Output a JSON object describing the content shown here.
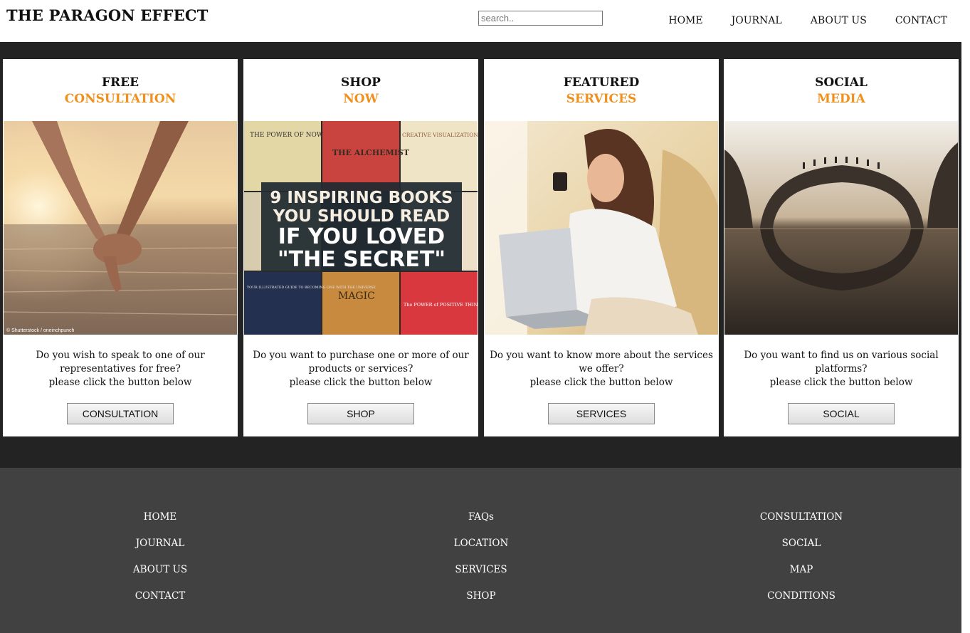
{
  "header": {
    "site_title": "THE PARAGON EFFECT",
    "search_placeholder": "search..",
    "nav": [
      "HOME",
      "JOURNAL",
      "ABOUT US",
      "CONTACT"
    ]
  },
  "cards": [
    {
      "heading_line1": "FREE",
      "heading_line2": "CONSULTATION",
      "text_lines": [
        "Do you wish to speak to one of our",
        "representatives for free?",
        "please click the button below"
      ],
      "button": "CONSULTATION",
      "image_caption": "© Shutterstock / oneinchpunch"
    },
    {
      "heading_line1": "SHOP",
      "heading_line2": "NOW",
      "text_lines": [
        "Do you want to purchase one or more of our",
        "products or services?",
        "please click the button below"
      ],
      "button": "SHOP",
      "banner": [
        "9 INSPIRING BOOKS",
        "YOU SHOULD READ",
        "IF YOU LOVED",
        "\"THE SECRET\""
      ],
      "book_titles": [
        "THE POWER OF NOW",
        "THE ALCHEMIST",
        "CREATIVE VISUALIZATION",
        "MAGIC",
        "The POWER of POSITIVE THINKING",
        "YOUR ILLUSTRATED GUIDE TO BECOMING ONE WITH THE UNIVERSE"
      ]
    },
    {
      "heading_line1": "FEATURED",
      "heading_line2": "SERVICES",
      "text_lines": [
        "Do you want to know more about the services",
        "we offer?",
        "please click the button below"
      ],
      "button": "SERVICES"
    },
    {
      "heading_line1": "SOCIAL",
      "heading_line2": "MEDIA",
      "text_lines": [
        "Do you want to find us on various social",
        "platforms?",
        "please click the button below"
      ],
      "button": "SOCIAL"
    }
  ],
  "footer": {
    "col1": [
      "HOME",
      "JOURNAL",
      "ABOUT US",
      "CONTACT"
    ],
    "col2": [
      "FAQs",
      "LOCATION",
      "SERVICES",
      "SHOP"
    ],
    "col3": [
      "CONSULTATION",
      "SOCIAL",
      "MAP",
      "CONDITIONS"
    ]
  },
  "colors": {
    "accent": "#f0901e",
    "band": "#232323",
    "footer": "#414141"
  }
}
